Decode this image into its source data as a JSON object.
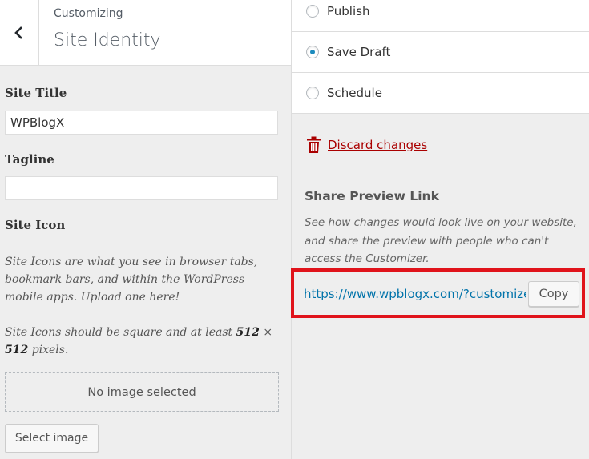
{
  "header": {
    "breadcrumb": "Customizing",
    "title": "Site Identity"
  },
  "icons": {
    "back": "chevron-left-icon",
    "discard": "trash-icon"
  },
  "site_title": {
    "label": "Site Title",
    "value": "WPBlogX"
  },
  "tagline": {
    "label": "Tagline",
    "value": ""
  },
  "site_icon": {
    "label": "Site Icon",
    "desc1": "Site Icons are what you see in browser tabs, bookmark bars, and within the WordPress mobile apps. Upload one here!",
    "desc2_prefix": "Site Icons should be square and at least",
    "desc2_w": "512",
    "desc2_x": "×",
    "desc2_h": "512",
    "desc2_suffix": "pixels.",
    "no_image": "No image selected",
    "select_button": "Select image"
  },
  "publish_options": [
    {
      "label": "Publish",
      "checked": false
    },
    {
      "label": "Save Draft",
      "checked": true
    },
    {
      "label": "Schedule",
      "checked": false
    }
  ],
  "discard": {
    "label": "Discard changes",
    "color": "#aa0000"
  },
  "share": {
    "title": "Share Preview Link",
    "description": "See how changes would look live on your website, and share the preview with people who can't access the Customizer.",
    "url": "https://www.wpblogx.com/?customize_changeset_uuid",
    "copy_label": "Copy"
  },
  "colors": {
    "link": "#0073aa",
    "radio_accent": "#1e8cbe",
    "highlight": "#e0131b"
  }
}
